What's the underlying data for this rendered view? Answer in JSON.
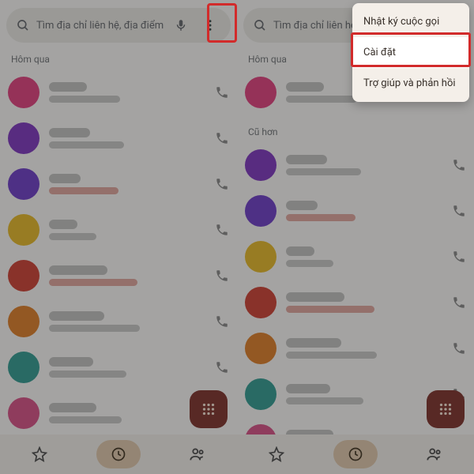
{
  "search": {
    "placeholder": "Tìm địa chỉ liên hệ, địa điểm"
  },
  "sections": {
    "yesterday": "Hôm qua",
    "older": "Cũ hơn"
  },
  "menu": {
    "call_log": "Nhật ký cuộc gọi",
    "settings": "Cài đặt",
    "help": "Trợ giúp và phản hồi"
  },
  "avatars": {
    "colors": {
      "pink": "#e33a7b",
      "purple": "#7b2fbf",
      "purple2": "#6a36c9",
      "yellow": "#e9b91f",
      "red": "#cf3a2b",
      "orange": "#e07a1f",
      "teal": "#2a9a8f",
      "pink2": "#d94a84"
    }
  },
  "rows_left": [
    {
      "color": "pink",
      "sub": "gray",
      "w1": 48,
      "w2": 90
    },
    {
      "color": "purple",
      "sub": "gray",
      "w1": 52,
      "w2": 95
    },
    {
      "color": "purple2",
      "sub": "red",
      "w1": 40,
      "w2": 88
    },
    {
      "color": "yellow",
      "sub": "gray",
      "w1": 36,
      "w2": 60
    },
    {
      "color": "red",
      "sub": "red",
      "w1": 74,
      "w2": 112
    },
    {
      "color": "orange",
      "sub": "gray",
      "w1": 70,
      "w2": 115
    },
    {
      "color": "teal",
      "sub": "gray",
      "w1": 56,
      "w2": 98
    },
    {
      "color": "pink2",
      "sub": "gray",
      "w1": 60,
      "w2": 92
    }
  ],
  "rows_right": [
    {
      "color": "pink",
      "sub": "gray",
      "w1": 48,
      "w2": 90
    },
    {
      "color": "purple",
      "sub": "gray",
      "w1": 52,
      "w2": 95
    },
    {
      "color": "purple2",
      "sub": "red",
      "w1": 40,
      "w2": 88
    },
    {
      "color": "yellow",
      "sub": "gray",
      "w1": 36,
      "w2": 60
    },
    {
      "color": "red",
      "sub": "red",
      "w1": 74,
      "w2": 112
    },
    {
      "color": "orange",
      "sub": "gray",
      "w1": 70,
      "w2": 115
    },
    {
      "color": "teal",
      "sub": "gray",
      "w1": 56,
      "w2": 98
    },
    {
      "color": "pink2",
      "sub": "gray",
      "w1": 60,
      "w2": 92
    }
  ]
}
